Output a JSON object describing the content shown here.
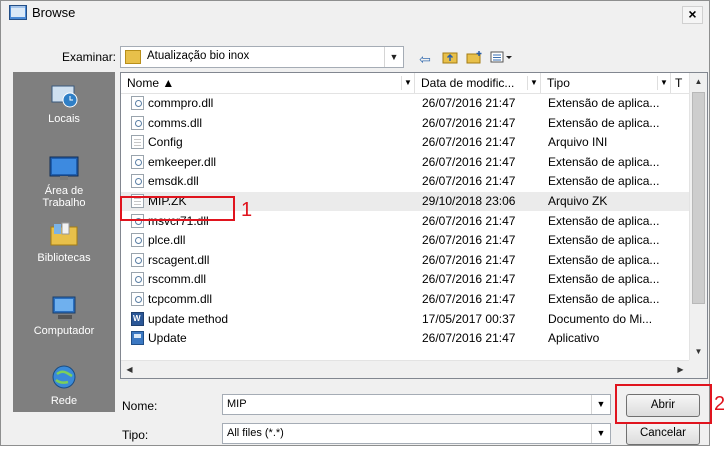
{
  "window": {
    "title": "Browse",
    "close_label": "×"
  },
  "look_in": {
    "label": "Examinar:",
    "value": "Atualização bio inox"
  },
  "toolbar": {
    "back_icon": "back-arrow-icon",
    "up_icon": "up-folder-icon",
    "new_folder_icon": "new-folder-icon",
    "views_icon": "views-menu-icon"
  },
  "places": [
    {
      "label": "Locais",
      "icon": "recent-places-icon"
    },
    {
      "label": "Área de Trabalho",
      "icon": "desktop-icon"
    },
    {
      "label": "Bibliotecas",
      "icon": "libraries-icon"
    },
    {
      "label": "Computador",
      "icon": "computer-icon"
    },
    {
      "label": "Rede",
      "icon": "network-icon"
    }
  ],
  "columns": [
    {
      "label": "Nome ▲"
    },
    {
      "label": "Data de modific..."
    },
    {
      "label": "Tipo"
    },
    {
      "label": "T"
    }
  ],
  "files": [
    {
      "name": "commpro.dll",
      "date": "26/07/2016 21:47",
      "type": "Extensão de aplica...",
      "icon": "dll"
    },
    {
      "name": "comms.dll",
      "date": "26/07/2016 21:47",
      "type": "Extensão de aplica...",
      "icon": "dll"
    },
    {
      "name": "Config",
      "date": "26/07/2016 21:47",
      "type": "Arquivo INI",
      "icon": "ini"
    },
    {
      "name": "emkeeper.dll",
      "date": "26/07/2016 21:47",
      "type": "Extensão de aplica...",
      "icon": "dll"
    },
    {
      "name": "emsdk.dll",
      "date": "26/07/2016 21:47",
      "type": "Extensão de aplica...",
      "icon": "dll"
    },
    {
      "name": "MIP.ZK",
      "date": "29/10/2018 23:06",
      "type": "Arquivo ZK",
      "icon": "zk"
    },
    {
      "name": "msvcr71.dll",
      "date": "26/07/2016 21:47",
      "type": "Extensão de aplica...",
      "icon": "dll"
    },
    {
      "name": "plce.dll",
      "date": "26/07/2016 21:47",
      "type": "Extensão de aplica...",
      "icon": "dll"
    },
    {
      "name": "rscagent.dll",
      "date": "26/07/2016 21:47",
      "type": "Extensão de aplica...",
      "icon": "dll"
    },
    {
      "name": "rscomm.dll",
      "date": "26/07/2016 21:47",
      "type": "Extensão de aplica...",
      "icon": "dll"
    },
    {
      "name": "tcpcomm.dll",
      "date": "26/07/2016 21:47",
      "type": "Extensão de aplica...",
      "icon": "dll"
    },
    {
      "name": "update method",
      "date": "17/05/2017 00:37",
      "type": "Documento do Mi...",
      "icon": "doc"
    },
    {
      "name": "Update",
      "date": "26/07/2016 21:47",
      "type": "Aplicativo",
      "icon": "app"
    }
  ],
  "filename": {
    "label": "Nome:",
    "value": "MIP"
  },
  "filetype": {
    "label": "Tipo:",
    "value": "All files (*.*)"
  },
  "buttons": {
    "open": "Abrir",
    "cancel": "Cancelar"
  },
  "annotations": {
    "marker1": "1",
    "marker2": "2",
    "color": "#e0141e"
  },
  "colors": {
    "places_bg": "#7f7f7f",
    "selection": "#ebebeb"
  }
}
